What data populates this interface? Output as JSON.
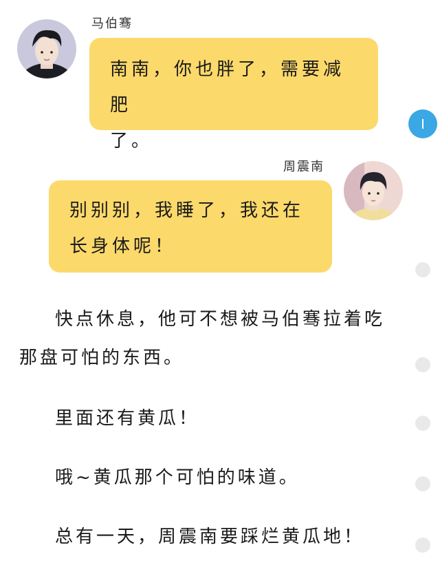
{
  "messages": [
    {
      "sender": "马伯骞",
      "side": "left",
      "lines": [
        "南南，你也胖了，需要减肥",
        "了。"
      ]
    },
    {
      "sender": "周震南",
      "side": "right",
      "lines": [
        "别别别，我睡了，我还在",
        "长身体呢！"
      ]
    }
  ],
  "narration": [
    {
      "lines": [
        "快点休息，他可不想被马伯骞拉着吃",
        "那盘可怕的东西。"
      ]
    },
    {
      "lines": [
        "里面还有黄瓜！"
      ]
    },
    {
      "lines": [
        "哦~黄瓜那个可怕的味道。"
      ]
    },
    {
      "lines": [
        "总有一天，周震南要踩烂黄瓜地！"
      ]
    }
  ],
  "colors": {
    "bubble": "#fcd96b",
    "scroll_active": "#3aa8e4",
    "scroll_inactive": "#e9e9e9"
  },
  "icons": {
    "avatar_left": "avatar-icon",
    "avatar_right": "avatar-icon",
    "scroll_indicator": "scroll-dot-icon"
  }
}
